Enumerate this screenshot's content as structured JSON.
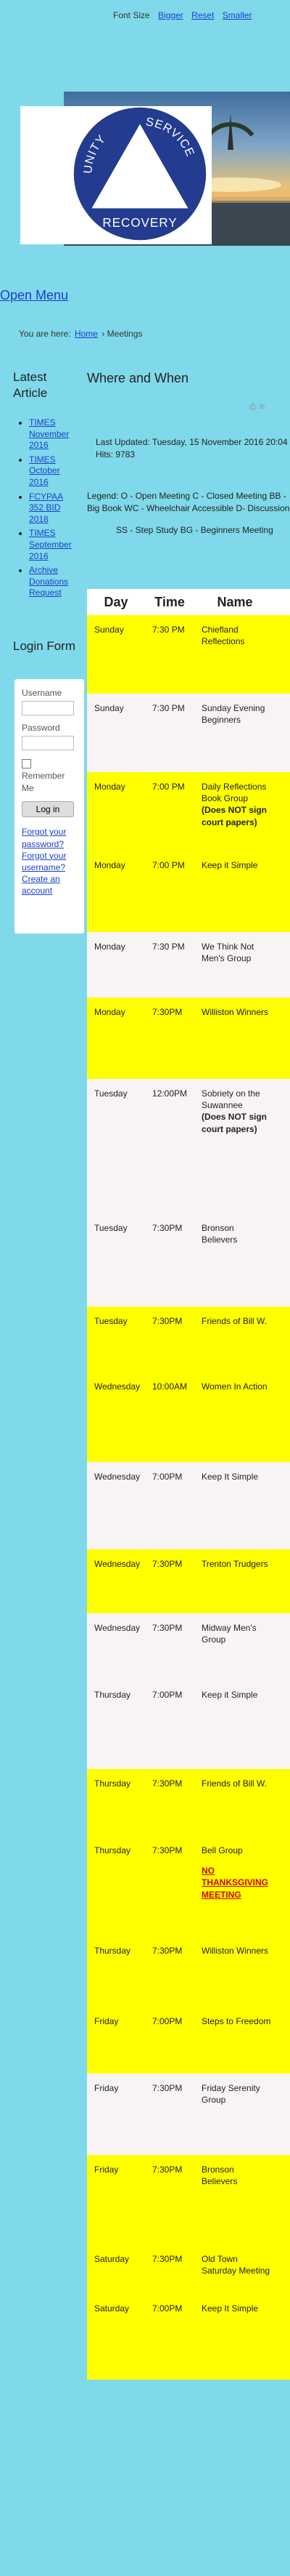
{
  "font_bar": {
    "label": "Font Size",
    "bigger": "Bigger",
    "reset": "Reset",
    "smaller": "Smaller"
  },
  "logo": {
    "top_text": "UNITY",
    "right_text": "SERVICE",
    "bottom_text": "RECOVERY"
  },
  "open_menu": "Open Menu",
  "breadcrumb": {
    "prefix": "You are here:",
    "home": "Home",
    "current": "Meetings"
  },
  "sidebar": {
    "latest_title": "Latest Article",
    "articles": [
      "TIMES November 2016",
      "TIMES October 2016",
      "FCYPAA 352 BID 2018",
      "TIMES September 2016",
      "Archive Donations Request"
    ],
    "login_title": "Login Form",
    "username_label": "Username",
    "password_label": "Password",
    "remember_label": "Remember Me",
    "login_button": "Log in",
    "forgot_password": "Forgot your password?",
    "forgot_username": "Forgot your username?",
    "create_account": "Create an account"
  },
  "main": {
    "title": "Where and When",
    "last_updated": "Last Updated: Tuesday, 15 November 2016 20:04",
    "hits": "Hits: 9783",
    "legend_1": "Legend:  O - Open Meeting   C - Closed Meeting  BB - Big Book     WC - Wheelchair Accessible   D- Discussion",
    "legend_2": "SS - Step Study    BG - Beginners Meeting"
  },
  "table": {
    "headers": [
      "Day",
      "Time",
      "Name"
    ],
    "rows": [
      {
        "day": "Sunday",
        "time": "7:30 PM",
        "name": "Chiefland Reflections",
        "note": "",
        "color": "yellow"
      },
      {
        "day": "Sunday",
        "time": "7:30 PM",
        "name": "Sunday Evening Beginners",
        "note": "",
        "color": "white"
      },
      {
        "day": "Monday",
        "time": "7:00 PM",
        "name": "Daily Reflections Book Group",
        "note": "(Does NOT sign court papers)",
        "color": "yellow"
      },
      {
        "day": "Monday",
        "time": "7:00 PM",
        "name": "Keep it Simple",
        "note": "",
        "color": "yellow"
      },
      {
        "day": "Monday",
        "time": "7:30 PM",
        "name": "We Think Not Men's Group",
        "note": "",
        "color": "white"
      },
      {
        "day": "Monday",
        "time": "7:30PM",
        "name": "Williston Winners",
        "note": "",
        "color": "yellow"
      },
      {
        "day": "Tuesday",
        "time": "12:00PM",
        "name": "Sobriety on the Suwannee",
        "note": "(Does NOT sign court papers)",
        "color": "white"
      },
      {
        "day": "Tuesday",
        "time": "7:30PM",
        "name": "Bronson Believers",
        "note": "",
        "color": "white"
      },
      {
        "day": "Tuesday",
        "time": "7:30PM",
        "name": "Friends of Bill W.",
        "note": "",
        "color": "yellow"
      },
      {
        "day": "Wednesday",
        "time": "10:00AM",
        "name": "Women In Action",
        "note": "",
        "color": "yellow"
      },
      {
        "day": "Wednesday",
        "time": "7:00PM",
        "name": "Keep It Simple",
        "note": "",
        "color": "white"
      },
      {
        "day": "Wednesday",
        "time": "7:30PM",
        "name": "Trenton Trudgers",
        "note": "",
        "color": "yellow"
      },
      {
        "day": "Wednesday",
        "time": "7:30PM",
        "name": "Midway Men's Group",
        "note": "",
        "color": "white"
      },
      {
        "day": "Thursday",
        "time": "7:00PM",
        "name": "Keep it Simple",
        "note": "",
        "color": "white"
      },
      {
        "day": "Thursday",
        "time": "7:30PM",
        "name": "Friends of Bill W.",
        "note": "",
        "color": "yellow"
      },
      {
        "day": "Thursday",
        "time": "7:30PM",
        "name": "Bell Group",
        "note": "NO THANKSGIVING MEETING",
        "color": "yellow"
      },
      {
        "day": "Thursday",
        "time": "7:30PM",
        "name": "Williston Winners",
        "note": "",
        "color": "yellow"
      },
      {
        "day": "Friday",
        "time": "7:00PM",
        "name": "Steps to Freedom",
        "note": "",
        "color": "yellow"
      },
      {
        "day": "Friday",
        "time": "7:30PM",
        "name": "Friday Serenity Group",
        "note": "",
        "color": "white"
      },
      {
        "day": "Friday",
        "time": "7:30PM",
        "name": "Bronson Believers",
        "note": "",
        "color": "yellow"
      },
      {
        "day": "Saturday",
        "time": "7:30PM",
        "name": "Old Town Saturday Meeting",
        "note": "",
        "color": "yellow"
      },
      {
        "day": "Saturday",
        "time": "7:00PM",
        "name": "Keep It Simple",
        "note": "",
        "color": "yellow"
      }
    ]
  }
}
